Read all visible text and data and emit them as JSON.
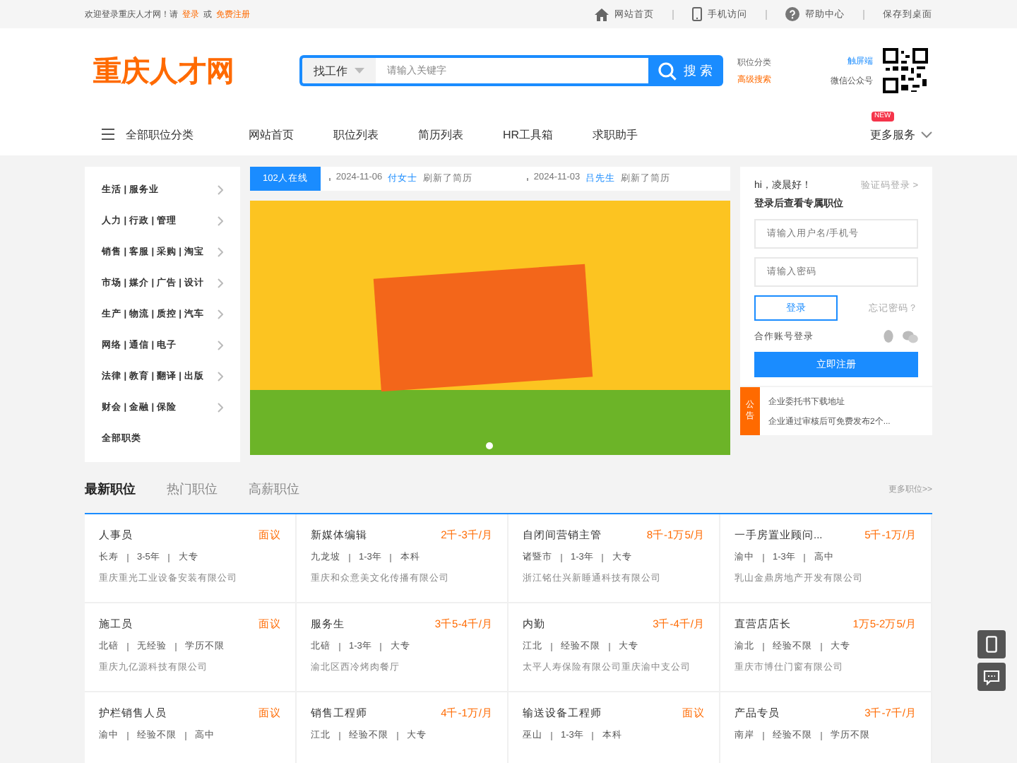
{
  "top_bar": {
    "welcome": "欢迎登录重庆人才网！请",
    "login": "登录",
    "or": "或",
    "register": "免费注册",
    "links": [
      {
        "label": "网站首页"
      },
      {
        "label": "手机访问"
      },
      {
        "label": "帮助中心"
      },
      {
        "label": "保存到桌面"
      }
    ]
  },
  "header": {
    "logo": "重庆人才网",
    "search": {
      "category": "找工作",
      "placeholder": "请输入关键字",
      "button": "搜 索"
    },
    "links": [
      {
        "label": "职位分类",
        "highlight": false
      },
      {
        "label": "高级搜索",
        "highlight": true
      }
    ],
    "qr": {
      "link": "触屏端",
      "caption": "微信公众号"
    }
  },
  "nav": {
    "all_categories": "全部职位分类",
    "items": [
      "网站首页",
      "职位列表",
      "简历列表",
      "HR工具箱",
      "求职助手"
    ],
    "more": {
      "label": "更多服务",
      "badge": "NEW"
    }
  },
  "categories": [
    {
      "label": "生活 | 服务业",
      "expandable": true
    },
    {
      "label": "人力 | 行政 | 管理",
      "expandable": true
    },
    {
      "label": "销售 | 客服 | 采购 | 淘宝",
      "expandable": true
    },
    {
      "label": "市场 | 媒介 | 广告 | 设计",
      "expandable": true
    },
    {
      "label": "生产 | 物流 | 质控 | 汽车",
      "expandable": true
    },
    {
      "label": "网络 | 通信 | 电子",
      "expandable": true
    },
    {
      "label": "法律 | 教育 | 翻译 | 出版",
      "expandable": true
    },
    {
      "label": "财会 | 金融 | 保险",
      "expandable": true
    },
    {
      "label": "全部职类",
      "expandable": false
    }
  ],
  "ticker": {
    "online": "102人在线",
    "entries": [
      {
        "date": "2024-11-06",
        "name": "付女士",
        "action": "刷新了简历"
      },
      {
        "date": "2024-11-03",
        "name": "吕先生",
        "action": "刷新了简历"
      }
    ]
  },
  "login": {
    "greeting": "hi，凌晨好！",
    "code_login": "验证码登录 >",
    "subtitle": "登录后查看专属职位",
    "username_placeholder": "请输入用户名/手机号",
    "password_placeholder": "请输入密码",
    "login_button": "登录",
    "forgot": "忘记密码？",
    "partner": "合作账号登录",
    "register": "立即注册"
  },
  "notice": {
    "badge": "公告",
    "items": [
      "企业委托书下载地址",
      "企业通过审核后可免费发布2个..."
    ]
  },
  "jobs": {
    "tabs": [
      {
        "label": "最新职位",
        "selected": true
      },
      {
        "label": "热门职位",
        "selected": false
      },
      {
        "label": "高薪职位",
        "selected": false
      }
    ],
    "more": "更多职位>>",
    "cards": [
      {
        "title": "人事员",
        "salary": "面议",
        "meta": [
          "长寿",
          "3-5年",
          "大专"
        ],
        "company": "重庆重光工业设备安装有限公司"
      },
      {
        "title": "新媒体编辑",
        "salary": "2千-3千/月",
        "meta": [
          "九龙坡",
          "1-3年",
          "本科"
        ],
        "company": "重庆和众意美文化传播有限公司"
      },
      {
        "title": "自闭间营销主管",
        "salary": "8千-1万5/月",
        "meta": [
          "诸暨市",
          "1-3年",
          "大专"
        ],
        "company": "浙江铭仕兴新睡通科技有限公司"
      },
      {
        "title": "一手房置业顾问...",
        "salary": "5千-1万/月",
        "meta": [
          "渝中",
          "1-3年",
          "高中"
        ],
        "company": "乳山金鼎房地产开发有限公司"
      },
      {
        "title": "施工员",
        "salary": "面议",
        "meta": [
          "北碚",
          "无经验",
          "学历不限"
        ],
        "company": "重庆九亿源科技有限公司"
      },
      {
        "title": "服务生",
        "salary": "3千5-4千/月",
        "meta": [
          "北碚",
          "1-3年",
          "大专"
        ],
        "company": "渝北区西冷烤肉餐厅"
      },
      {
        "title": "内勤",
        "salary": "3千-4千/月",
        "meta": [
          "江北",
          "经验不限",
          "大专"
        ],
        "company": "太平人寿保险有限公司重庆渝中支公司"
      },
      {
        "title": "直营店店长",
        "salary": "1万5-2万5/月",
        "meta": [
          "渝北",
          "经验不限",
          "大专"
        ],
        "company": "重庆市博仕门窗有限公司"
      },
      {
        "title": "护栏销售人员",
        "salary": "面议",
        "meta": [
          "渝中",
          "经验不限",
          "高中"
        ]
      },
      {
        "title": "销售工程师",
        "salary": "4千-1万/月",
        "meta": [
          "江北",
          "经验不限",
          "大专"
        ]
      },
      {
        "title": "输送设备工程师",
        "salary": "面议",
        "meta": [
          "巫山",
          "1-3年",
          "本科"
        ]
      },
      {
        "title": "产品专员",
        "salary": "3千-7千/月",
        "meta": [
          "南岸",
          "经验不限",
          "学历不限"
        ]
      }
    ]
  }
}
